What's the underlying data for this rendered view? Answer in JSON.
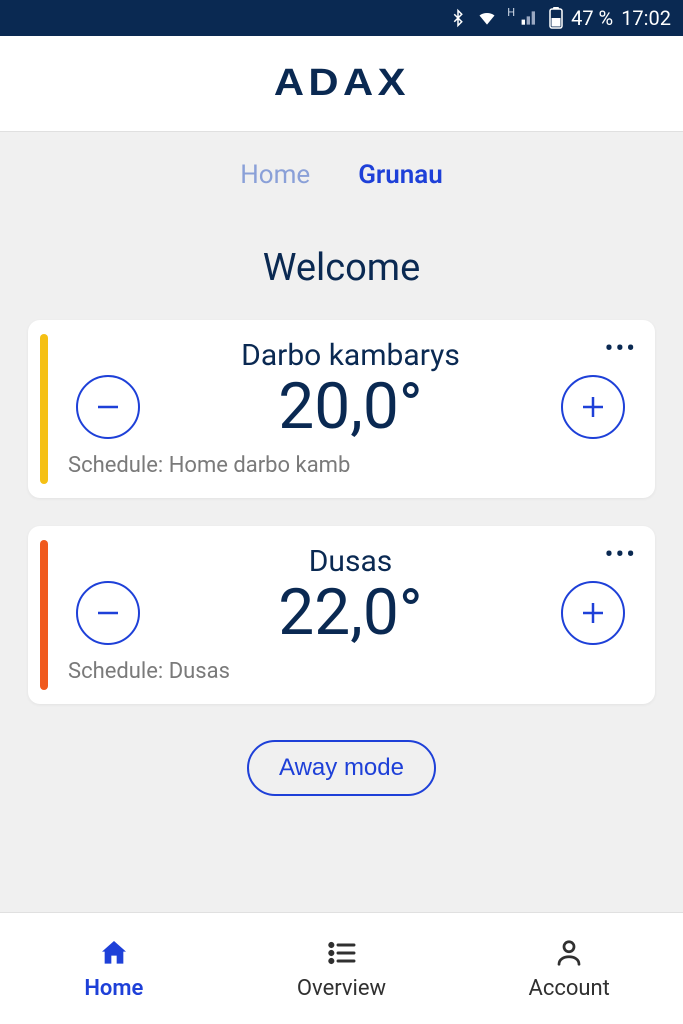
{
  "status": {
    "network_badge": "H",
    "battery_pct": "47 %",
    "time": "17:02"
  },
  "header": {
    "logo": "ADAX"
  },
  "tabs": [
    {
      "label": "Home",
      "active": false
    },
    {
      "label": "Grunau",
      "active": true
    }
  ],
  "welcome": "Welcome",
  "rooms": [
    {
      "name": "Darbo kambarys",
      "temperature": "20,0°",
      "schedule_label": "Schedule: Home darbo kamb",
      "stripe_color": "yellow"
    },
    {
      "name": "Dusas",
      "temperature": "22,0°",
      "schedule_label": "Schedule: Dusas",
      "stripe_color": "orange"
    }
  ],
  "away_button": "Away mode",
  "bottom_nav": [
    {
      "label": "Home",
      "icon": "home",
      "active": true
    },
    {
      "label": "Overview",
      "icon": "list",
      "active": false
    },
    {
      "label": "Account",
      "icon": "person",
      "active": false
    }
  ]
}
